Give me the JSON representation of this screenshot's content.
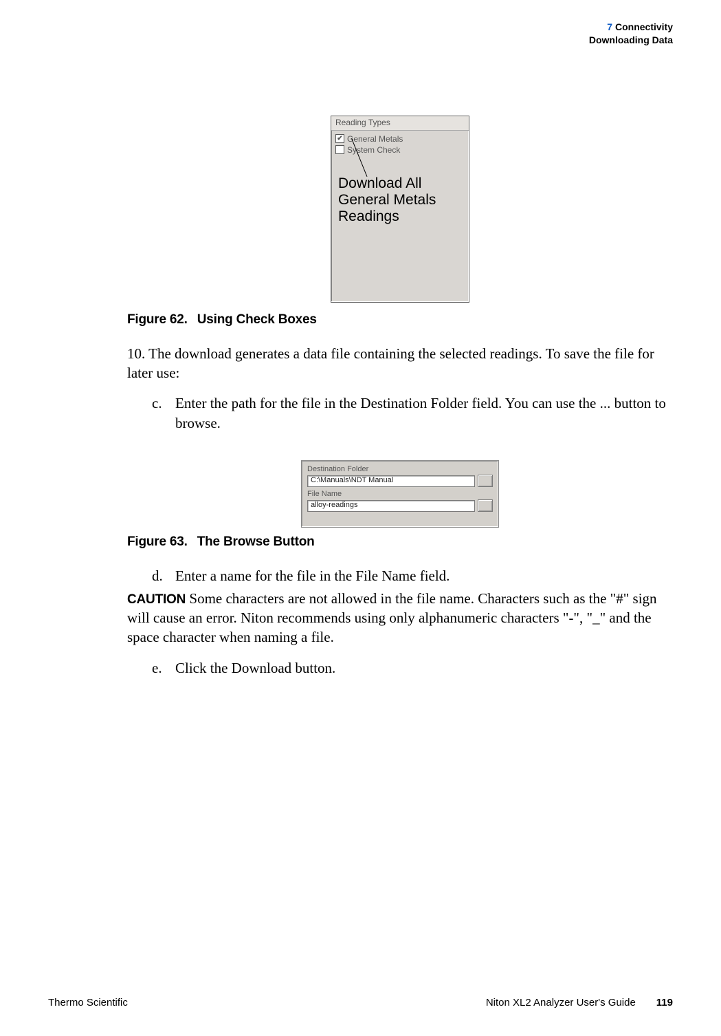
{
  "header": {
    "chapter_number": "7",
    "chapter_title": "Connectivity",
    "section_title": "Downloading Data"
  },
  "fig62": {
    "panel_header": "Reading Types",
    "item1": "General Metals",
    "item1_checked": "✔",
    "item2": "System Check",
    "callout_l1": "Download All",
    "callout_l2": "General Metals",
    "callout_l3": "Readings",
    "caption_label": "Figure 62.",
    "caption_text": "Using Check Boxes"
  },
  "para10": "10. The download generates a data file containing the selected readings. To save the file for later use:",
  "step_c_letter": "c.",
  "step_c_text": "Enter the path for the file in the Destination Folder field. You can use the ... button to browse.",
  "fig63": {
    "label_dest": "Destination Folder",
    "value_dest": "C:\\Manuals\\NDT Manual",
    "label_file": "File Name",
    "value_file": "alloy-readings",
    "caption_label": "Figure 63.",
    "caption_text": "The Browse Button"
  },
  "step_d_letter": "d.",
  "step_d_text": "Enter a name for the file in the File Name field.",
  "caution_label": "CAUTION",
  "caution_text": "  Some characters are not allowed in the file name. Characters such as the \"#\" sign will cause an error. Niton recommends using only alphanumeric characters \"-\", \"_\" and the space character when naming a file.",
  "step_e_letter": "e.",
  "step_e_text": "Click the Download button.",
  "footer": {
    "left": "Thermo Scientific",
    "guide": "Niton XL2 Analyzer User's Guide",
    "page": "119"
  }
}
